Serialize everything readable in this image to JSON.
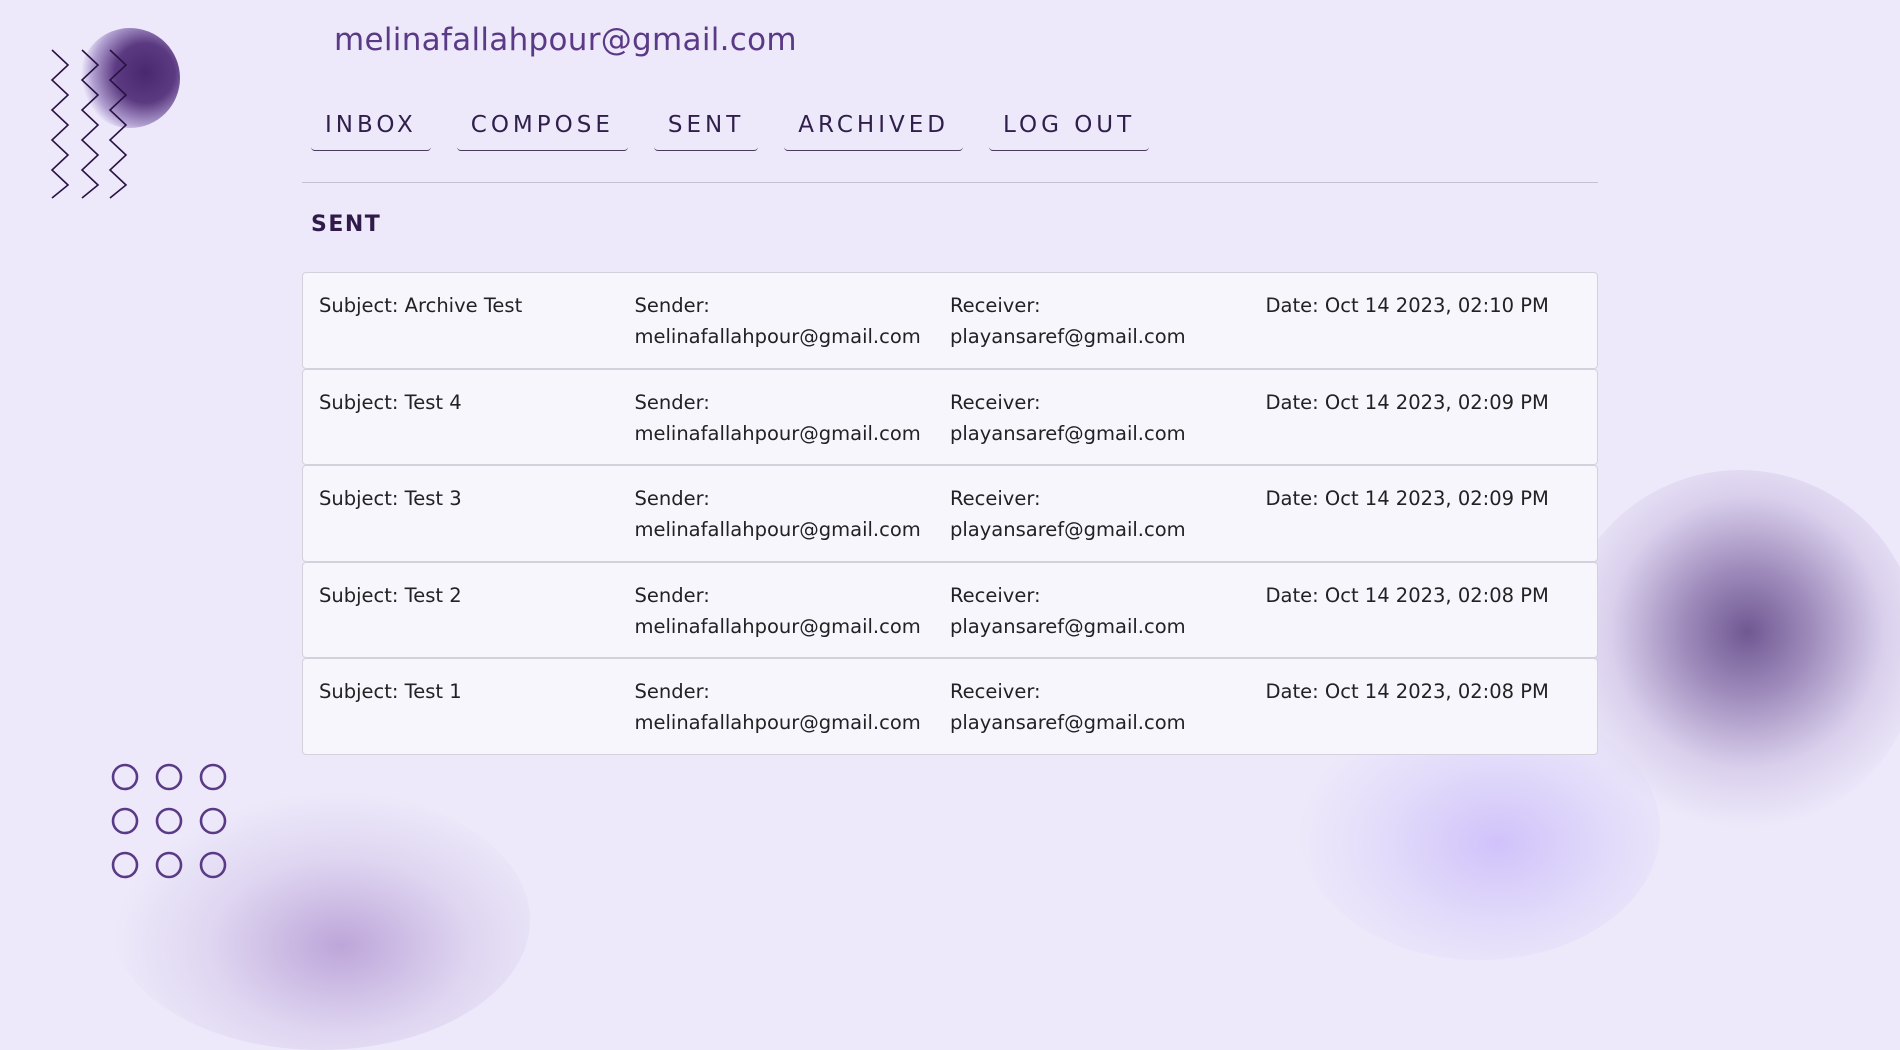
{
  "user": {
    "email": "melinafallahpour@gmail.com"
  },
  "nav": [
    {
      "id": "inbox",
      "label": "INBOX"
    },
    {
      "id": "compose",
      "label": "COMPOSE"
    },
    {
      "id": "sent",
      "label": "SENT"
    },
    {
      "id": "archived",
      "label": "ARCHIVED"
    },
    {
      "id": "logout",
      "label": "LOG OUT"
    }
  ],
  "section": {
    "title": "SENT"
  },
  "emails": [
    {
      "subject": "Subject: Archive Test",
      "sender_label": "Sender:",
      "sender": "melinafallahpour@gmail.com",
      "receiver_label": "Receiver:",
      "receiver": "playansaref@gmail.com",
      "date": "Date: Oct 14 2023, 02:10 PM"
    },
    {
      "subject": "Subject: Test 4",
      "sender_label": "Sender:",
      "sender": "melinafallahpour@gmail.com",
      "receiver_label": "Receiver:",
      "receiver": "playansaref@gmail.com",
      "date": "Date: Oct 14 2023, 02:09 PM"
    },
    {
      "subject": "Subject: Test 3",
      "sender_label": "Sender:",
      "sender": "melinafallahpour@gmail.com",
      "receiver_label": "Receiver:",
      "receiver": "playansaref@gmail.com",
      "date": "Date: Oct 14 2023, 02:09 PM"
    },
    {
      "subject": "Subject: Test 2",
      "sender_label": "Sender:",
      "sender": "melinafallahpour@gmail.com",
      "receiver_label": "Receiver:",
      "receiver": "playansaref@gmail.com",
      "date": "Date: Oct 14 2023, 02:08 PM"
    },
    {
      "subject": "Subject: Test 1",
      "sender_label": "Sender:",
      "sender": "melinafallahpour@gmail.com",
      "receiver_label": "Receiver:",
      "receiver": "playansaref@gmail.com",
      "date": "Date: Oct 14 2023, 02:08 PM"
    }
  ],
  "decor": {
    "icons": [
      "zigzag-pattern-icon",
      "circle-grid-icon"
    ],
    "colors": {
      "accent": "#5a3a86",
      "background": "#ede9fa",
      "row_bg": "#f8f6fd"
    }
  }
}
